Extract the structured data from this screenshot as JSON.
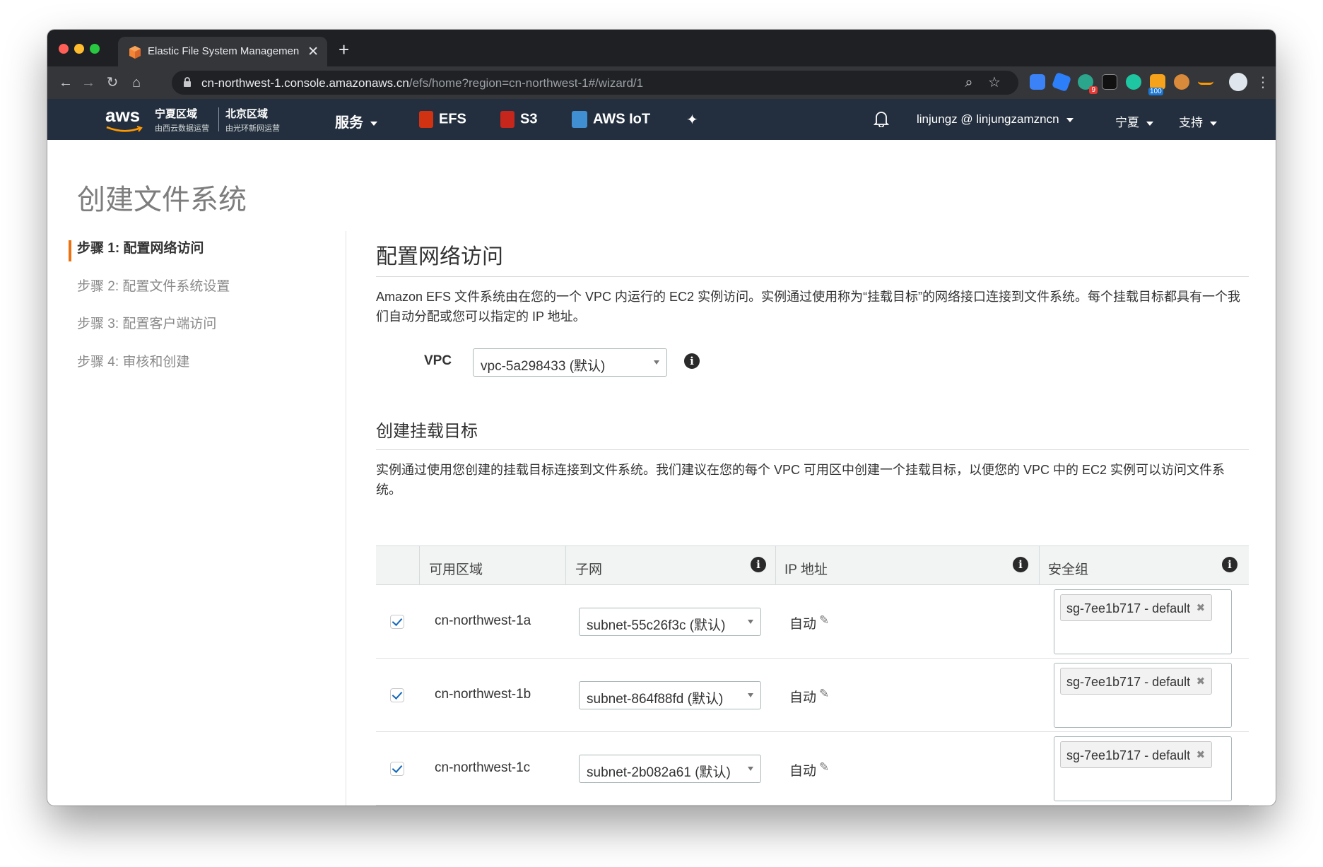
{
  "browser": {
    "tab_title": "Elastic File System Management",
    "new_tab_symbol": "+",
    "url_host": "cn-northwest-1.console.amazonaws.cn",
    "url_path": "/efs/home?region=cn-northwest-1#/wizard/1",
    "extension_badges": {
      "badge_a": "9",
      "badge_b": "100"
    }
  },
  "aws_nav": {
    "logo": "aws",
    "region1_title": "宁夏区域",
    "region1_sub": "由西云数据运营",
    "region2_title": "北京区域",
    "region2_sub": "由光环新网运营",
    "services_label": "服务",
    "shortcuts": [
      "EFS",
      "S3",
      "AWS IoT"
    ],
    "account_label": "linjungz @ linjungzamzncn",
    "region_label": "宁夏",
    "support_label": "支持"
  },
  "page": {
    "title": "创建文件系统",
    "steps": [
      "步骤 1: 配置网络访问",
      "步骤 2: 配置文件系统设置",
      "步骤 3: 配置客户端访问",
      "步骤 4: 审核和创建"
    ],
    "active_step": 0
  },
  "network": {
    "heading": "配置网络访问",
    "description": "Amazon EFS 文件系统由在您的一个 VPC 内运行的 EC2 实例访问。实例通过使用称为“挂载目标”的网络接口连接到文件系统。每个挂载目标都具有一个我们自动分配或您可以指定的 IP 地址。",
    "vpc_label": "VPC",
    "vpc_value": "vpc-5a298433 (默认)"
  },
  "mount_targets": {
    "heading": "创建挂载目标",
    "description": "实例通过使用您创建的挂载目标连接到文件系统。我们建议在您的每个 VPC 可用区中创建一个挂载目标，以便您的 VPC 中的 EC2 实例可以访问文件系统。",
    "columns": [
      "可用区域",
      "子网",
      "IP 地址",
      "安全组"
    ],
    "rows": [
      {
        "checked": true,
        "az": "cn-northwest-1a",
        "subnet": "subnet-55c26f3c (默认)",
        "ip": "自动",
        "security_group": "sg-7ee1b717 - default"
      },
      {
        "checked": true,
        "az": "cn-northwest-1b",
        "subnet": "subnet-864f88fd (默认)",
        "ip": "自动",
        "security_group": "sg-7ee1b717 - default"
      },
      {
        "checked": true,
        "az": "cn-northwest-1c",
        "subnet": "subnet-2b082a61 (默认)",
        "ip": "自动",
        "security_group": "sg-7ee1b717 - default"
      }
    ]
  },
  "colors": {
    "aws_nav_bg": "#232f3e",
    "accent_orange": "#ec7211",
    "checkbox_blue": "#1166bb"
  }
}
